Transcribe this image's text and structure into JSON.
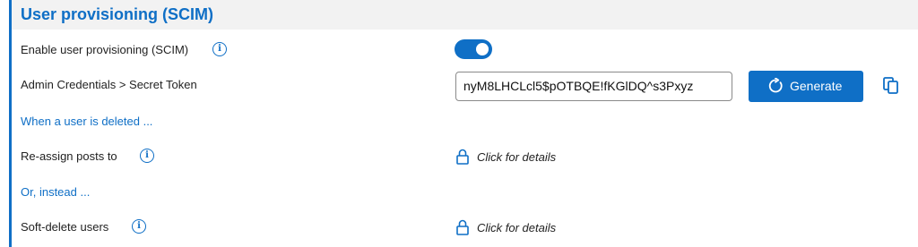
{
  "section": {
    "title": "User provisioning (SCIM)"
  },
  "rows": {
    "enable": {
      "label": "Enable user provisioning (SCIM)",
      "toggle_on": true
    },
    "secret": {
      "label": "Admin Credentials > Secret Token",
      "token_value": "nyM8LHCLcl5$pOTBQE!fKGlDQ^s3Pxyz",
      "generate_label": "Generate"
    },
    "deleted_link": "When a user is deleted ...",
    "reassign": {
      "label": "Re-assign posts to",
      "details": "Click for details"
    },
    "instead_link": "Or, instead ...",
    "softdelete": {
      "label": "Soft-delete users",
      "details": "Click for details"
    }
  },
  "icons": {
    "info": "i",
    "generate": "refresh-icon",
    "copy": "copy-icon",
    "lock": "lock-icon"
  },
  "colors": {
    "accent": "#0f6fc6",
    "header_bg": "#f2f2f2"
  }
}
